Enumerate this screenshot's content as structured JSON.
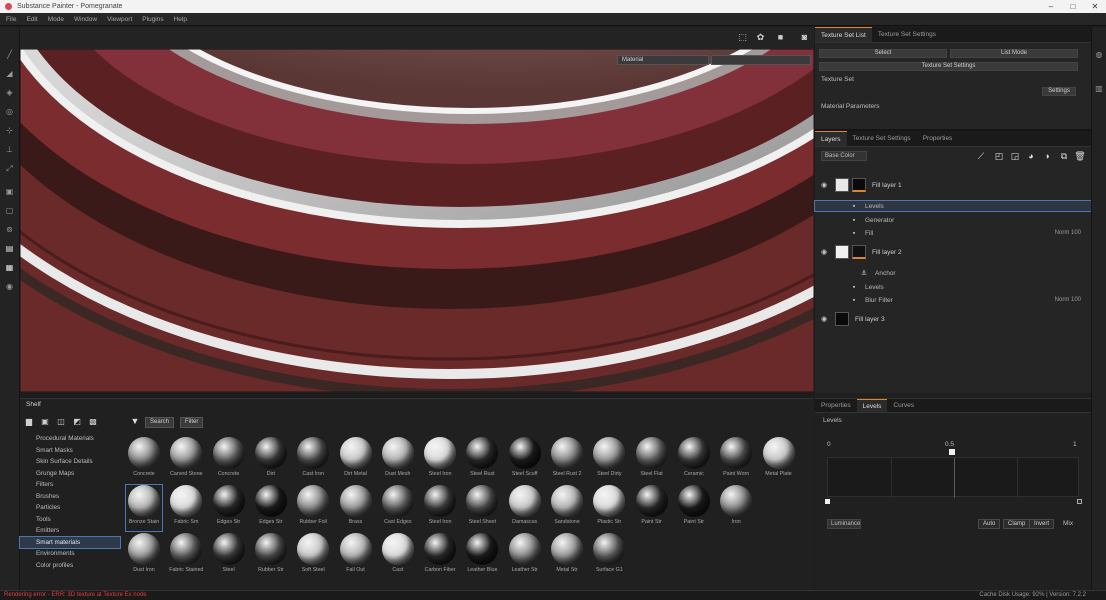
{
  "window": {
    "title": "Substance Painter - Pomegranate",
    "buttons": [
      "–",
      "□",
      "✕"
    ]
  },
  "menu": [
    "File",
    "Edit",
    "Mode",
    "Window",
    "Viewport",
    "Plugins",
    "Help"
  ],
  "left_tools": [
    "paint",
    "eraser",
    "projection",
    "smudge",
    "clone",
    "picker",
    "fill",
    "polygon-fill",
    "selection",
    "geometry",
    "bake",
    "render",
    "help"
  ],
  "viewport": {
    "toolbar_icons": [
      "screenshot",
      "camera-settings",
      "record",
      "display-settings"
    ],
    "material_mode": "Material",
    "channel_mode": "",
    "center_label": "..."
  },
  "texture_set_panel": {
    "tabs": [
      "Texture Set List",
      "Texture Set Settings"
    ],
    "rows": [
      "Select",
      "Texture Set Settings",
      "List Mode"
    ],
    "section_label": "Texture Set",
    "button": "Settings",
    "subsection": "Material Parameters"
  },
  "layers_panel": {
    "tabs": [
      "Layers",
      "Texture Set Settings",
      "Properties"
    ],
    "blend_mode": "Base Color",
    "toolbar_icons": [
      "add-effect",
      "add-fill",
      "add-layer",
      "add-mask",
      "add-folder",
      "duplicate",
      "delete"
    ],
    "layers": [
      {
        "name": "Fill layer 1",
        "sub": [
          {
            "name": "Levels"
          },
          {
            "name": "Generator"
          },
          {
            "name": "Fill",
            "meta": "Norm 100"
          }
        ]
      },
      {
        "name": "Fill layer 2",
        "sub": [
          {
            "name": "Anchor"
          },
          {
            "name": "Levels"
          },
          {
            "name": "Blur Filter",
            "meta": "Norm 100"
          }
        ]
      },
      {
        "name": "Fill layer 3",
        "sub": []
      }
    ]
  },
  "shelf": {
    "title": "Shelf",
    "categories": [
      "Procedural Materials",
      "Smart Masks",
      "Skin Surface Details",
      "Grunge Maps",
      "Filters",
      "Brushes",
      "Particles",
      "Tools",
      "Emitters",
      "Smart materials",
      "Environments",
      "Color profiles"
    ],
    "search_chip": "Search",
    "filter_label": "Filter",
    "materials": [
      "Concrete",
      "Carved Stone",
      "Concrete",
      "Dirt",
      "Cast Iron",
      "Dirt Metal",
      "Dust Mesh",
      "Steel Iron",
      "Steel Rust",
      "Steel Scuff",
      "Steel Rust 2",
      "Steel Dirty",
      "Steel Flat",
      "Ceramic",
      "Paint Worn",
      "Metal Plate",
      "Bronze Stain",
      "Fabric Sm",
      "Edges Str",
      "Edges Str",
      "Rubber Foil",
      "Brass",
      "Cast Edges",
      "Steel Iron",
      "Steel Sheet",
      "Damascus",
      "Sandstone",
      "Plastic Str",
      "Paint Str",
      "Paint Str",
      "Iron",
      "Dust Iron",
      "Fabric Stained",
      "Steel",
      "Rubber Str",
      "Soft Steel",
      "Fall Out",
      "Cast",
      "Carbon Fiber",
      "Leather Blue",
      "Leather Str",
      "Metal Str",
      "Surface G1"
    ]
  },
  "properties": {
    "tabs": [
      "Properties",
      "Levels",
      "Curves"
    ],
    "section": "Levels",
    "marker_labels": [
      "0",
      "0.5",
      "1"
    ],
    "channel": "Luminance",
    "buttons": [
      "Auto",
      "Clamp",
      "Invert"
    ],
    "extra": "Mix"
  },
  "status": {
    "error": "Rendering error - ERR: 3D texture at Texture Ex node",
    "right": "Cache Disk Usage: 92% | Version: 7.2.2"
  }
}
